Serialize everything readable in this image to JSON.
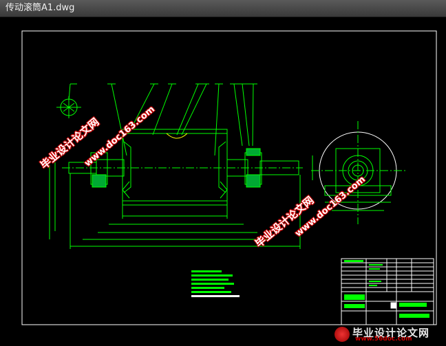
{
  "window": {
    "title": "传动滚筒A1.dwg"
  },
  "colors": {
    "background": "#000000",
    "frame": "#ffffff",
    "geometry": "#00ff00",
    "highlight": "#ffff00",
    "watermark_text": "#ffffff",
    "watermark_outline": "#cc0000"
  },
  "watermarks": {
    "site": "毕业设计论文网",
    "url": "www.doc163.com",
    "logo_brand": "毕业设计论文网",
    "logo_url": "www.56doc.com"
  }
}
